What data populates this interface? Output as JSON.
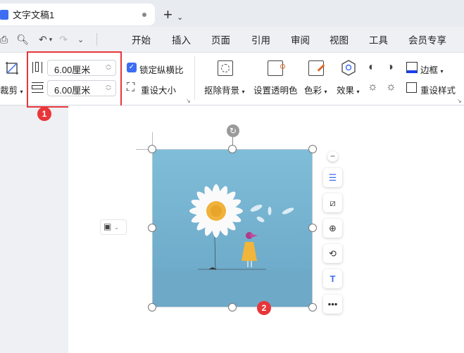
{
  "tab": {
    "title": "文字文稿1",
    "new_tab": "+",
    "dropdown": "⌄"
  },
  "menu": [
    "开始",
    "插入",
    "页面",
    "引用",
    "审阅",
    "视图",
    "工具",
    "会员专享"
  ],
  "ribbon": {
    "crop": "裁剪",
    "height_value": "6.00厘米",
    "width_value": "6.00厘米",
    "lock_ratio": "锁定纵横比",
    "lock_ratio_checked": true,
    "reset_size": "重设大小",
    "remove_bg": "抠除背景",
    "set_transparent": "设置透明色",
    "color": "色彩",
    "effects": "效果",
    "border": "边框",
    "reset_style": "重设样式"
  },
  "badges": {
    "one": "1",
    "two": "2"
  },
  "colors": {
    "accent": "#3d6df2",
    "highlight": "#e8363a",
    "border_blue": "#1a3ee8"
  }
}
